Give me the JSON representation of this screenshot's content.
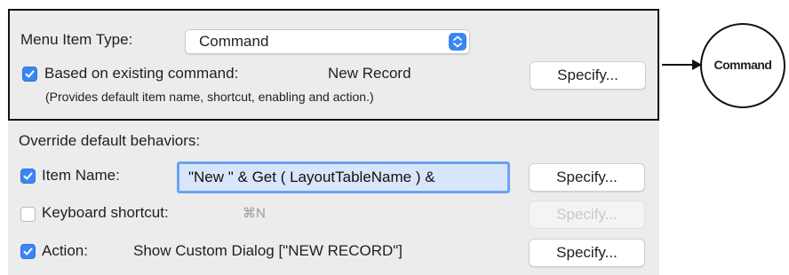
{
  "menu_item_type": {
    "label": "Menu Item Type:",
    "value": "Command"
  },
  "based_on": {
    "checked": true,
    "label": "Based on existing command:",
    "command": "New Record",
    "note": "(Provides default item name, shortcut, enabling and action.)",
    "button_label": "Specify..."
  },
  "override": {
    "heading": "Override default behaviors:",
    "item_name": {
      "checked": true,
      "label": "Item Name:",
      "value": "\"New \" & Get ( LayoutTableName ) &",
      "button_label": "Specify..."
    },
    "keyboard_shortcut": {
      "checked": false,
      "label": "Keyboard shortcut:",
      "value": "⌘N",
      "button_label": "Specify...",
      "button_enabled": false
    },
    "action": {
      "checked": true,
      "label": "Action:",
      "value": "Show Custom Dialog [\"NEW RECORD\"]",
      "button_label": "Specify..."
    }
  },
  "callout": {
    "label": "Command"
  },
  "colors": {
    "accent": "#3b86f4",
    "panel_bg": "#ececec",
    "highlight_border": "#111111"
  }
}
